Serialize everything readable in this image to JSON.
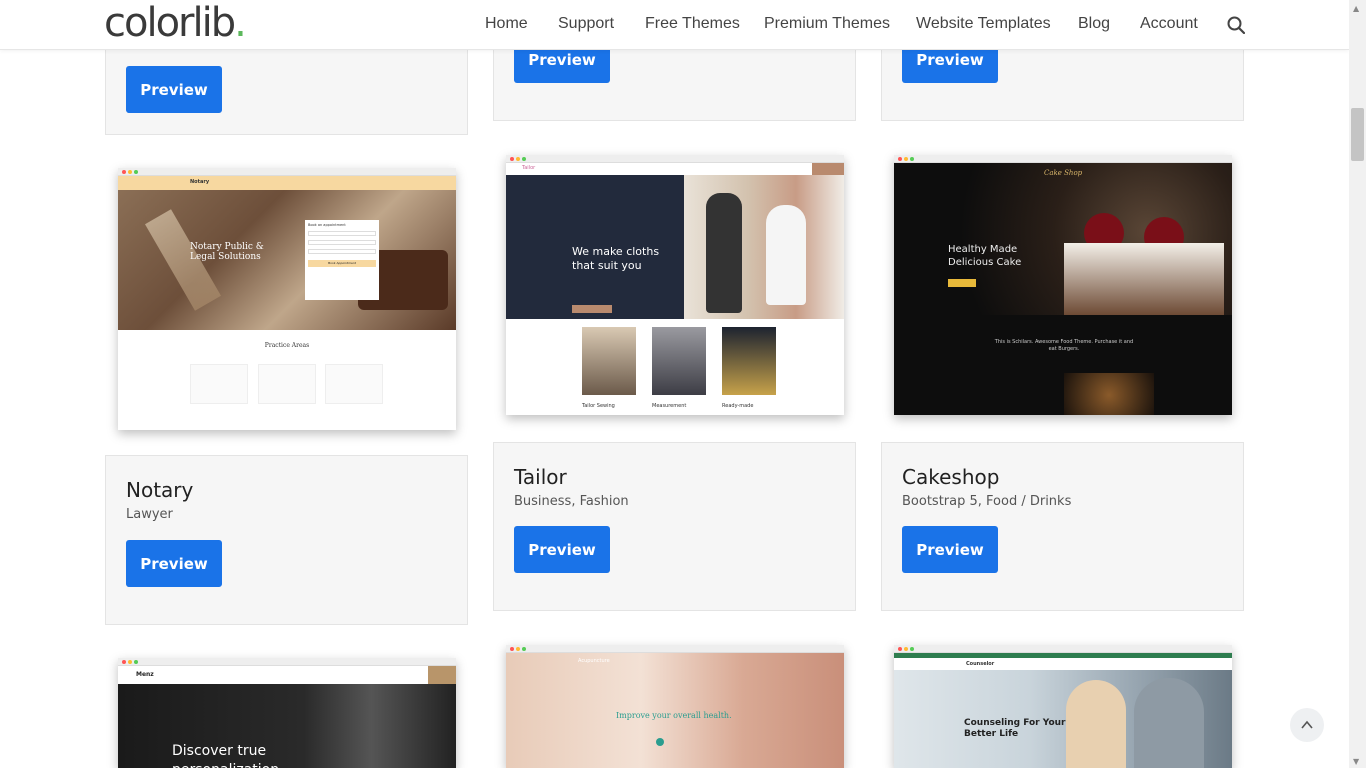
{
  "logo": {
    "text": "colorlib",
    "dot": "."
  },
  "nav": {
    "items": [
      "Home",
      "Support",
      "Free Themes",
      "Premium Themes",
      "Website Templates",
      "Blog",
      "Account"
    ]
  },
  "buttons": {
    "preview": "Preview"
  },
  "cards": [
    {
      "title": "Notary",
      "categories": "Lawyer"
    },
    {
      "title": "Tailor",
      "categories": "Business, Fashion"
    },
    {
      "title": "Cakeshop",
      "categories": "Bootstrap 5, Food / Drinks"
    }
  ],
  "thumbs": {
    "notary": {
      "brand": "Notary",
      "headline": "Notary Public & Legal Solutions",
      "section": "Practice Areas",
      "form_title": "Book an appointment",
      "form_button": "Book Appointment"
    },
    "tailor": {
      "brand": "Tailor",
      "headline": "We make cloths that suit you",
      "labels": [
        "Tailor Sewing",
        "Measurement",
        "Ready-made"
      ]
    },
    "cakeshop": {
      "brand": "Cake Shop",
      "headline": "Healthy Made Delicious Cake",
      "tagline": "This is Schilars. Awesome Food Theme. Purchase it and eat Burgers."
    },
    "menz": {
      "brand": "Menz",
      "headline": "Discover true personalization."
    },
    "acupuncture": {
      "brand": "Acupuncture",
      "headline": "Improve your overall health."
    },
    "counselor": {
      "brand": "Counselor",
      "headline": "Counseling For Your Better Life"
    }
  },
  "colors": {
    "accent": "#1a73e8",
    "logo_dot": "#5cb85c"
  }
}
